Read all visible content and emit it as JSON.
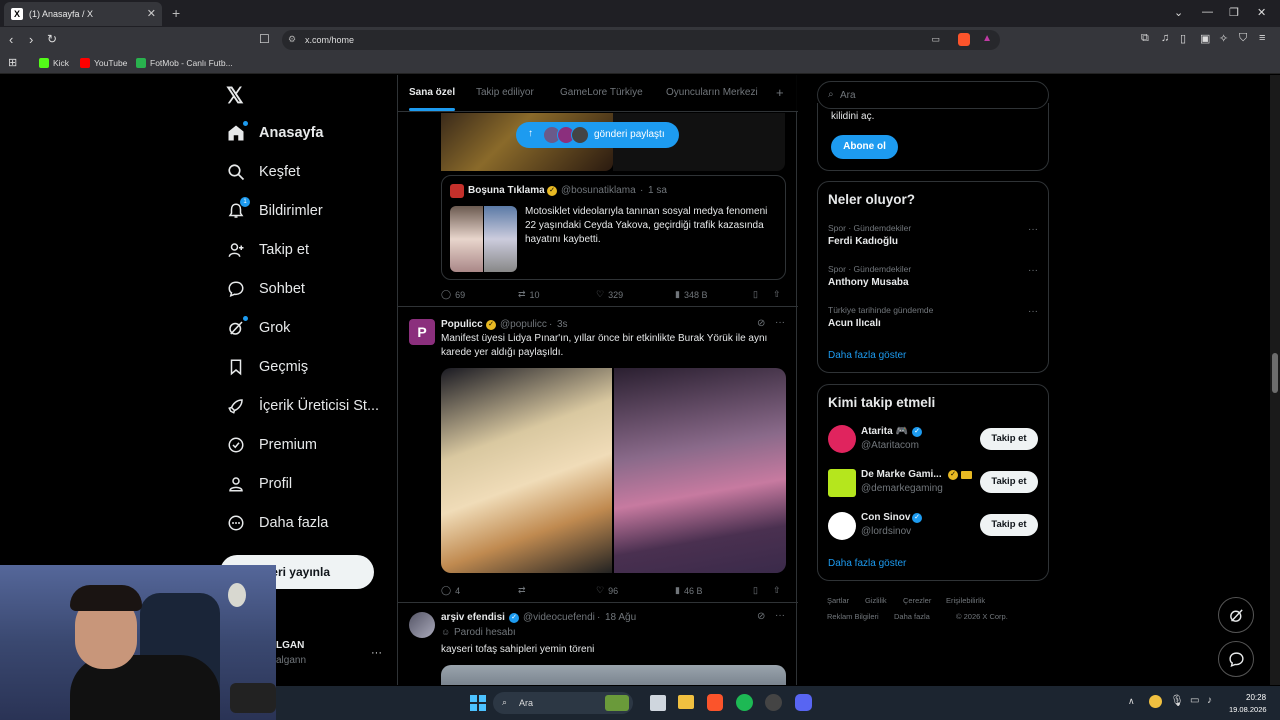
{
  "browser": {
    "tab_title": "(1) Anasayfa / X",
    "tab_favicon": "X",
    "url": "x.com/home",
    "bookmarks": [
      "Kick",
      "YouTube",
      "FotMob - Canlı Futb..."
    ]
  },
  "nav": {
    "items": [
      {
        "label": "Anasayfa",
        "icon": "home-icon"
      },
      {
        "label": "Keşfet",
        "icon": "search-icon"
      },
      {
        "label": "Bildirimler",
        "icon": "bell-icon",
        "badge": "1"
      },
      {
        "label": "Takip et",
        "icon": "person-plus-icon"
      },
      {
        "label": "Sohbet",
        "icon": "chat-icon"
      },
      {
        "label": "Grok",
        "icon": "grok-icon"
      },
      {
        "label": "Geçmiş",
        "icon": "bookmark-icon"
      },
      {
        "label": "İçerik Üreticisi St...",
        "icon": "rocket-icon"
      },
      {
        "label": "Premium",
        "icon": "verified-icon"
      },
      {
        "label": "Profil",
        "icon": "person-icon"
      },
      {
        "label": "Daha fazla",
        "icon": "more-circle-icon"
      }
    ],
    "post_button": "deri yayınla",
    "account_name": "LGAN",
    "account_handle": "algann"
  },
  "feed": {
    "tabs": [
      "Sana özel",
      "Takip ediliyor",
      "GameLore Türkiye",
      "Oyuncuların Merkezi"
    ],
    "share_pill": "gönderi paylaştı",
    "quoted_post": {
      "name": "Boşuna Tıklama",
      "handle": "@bosunatiklama",
      "time": "1 sa",
      "text": "Motosiklet videolarıyla tanınan sosyal medya fenomeni 22 yaşındaki Ceyda Yakova, geçirdiği trafik kazasında hayatını kaybetti.",
      "stats": {
        "replies": "69",
        "reposts": "10",
        "likes": "329",
        "views": "348 B"
      }
    },
    "post2": {
      "name": "Populicc",
      "handle": "@populicc",
      "time": "3s",
      "text": "Manifest üyesi Lidya Pınar'ın, yıllar önce bir etkinlikte Burak Yörük ile aynı karede yer aldığı paylaşıldı.",
      "stats": {
        "replies": "4",
        "reposts": "",
        "likes": "96",
        "views": "46 B"
      }
    },
    "post3": {
      "name": "arşiv efendisi",
      "handle": "@videocuefendi",
      "time": "18 Ağu",
      "subtitle": "Parodi hesabı",
      "text": "kayseri tofaş sahipleri yemin töreni"
    }
  },
  "sidebar": {
    "search_placeholder": "Ara",
    "premium_text": "kilidini aç.",
    "subscribe_button": "Abone ol",
    "trends_title": "Neler oluyor?",
    "trends": [
      {
        "category": "Spor · Gündemdekiler",
        "name": "Ferdi Kadıoğlu"
      },
      {
        "category": "Spor · Gündemdekiler",
        "name": "Anthony Musaba"
      },
      {
        "category": "Türkiye tarihinde gündemde",
        "name": "Acun Ilıcalı"
      }
    ],
    "trends_more": "Daha fazla göster",
    "who_to_follow_title": "Kimi takip etmeli",
    "suggestions": [
      {
        "name": "Atarita 🎮",
        "handle": "@Ataritacom",
        "button": "Takip et",
        "color": "#e0245e"
      },
      {
        "name": "De Marke Gami...",
        "handle": "@demarkegaming",
        "button": "Takip et",
        "color": "#b5e61d"
      },
      {
        "name": "Con Sinov",
        "handle": "@lordsinov",
        "button": "Takip et",
        "color": "#ffffff"
      }
    ],
    "follow_more": "Daha fazla göster",
    "footer": [
      "Şartlar",
      "Gizlilik",
      "Çerezler",
      "Erişilebilirlik",
      "Reklam Bilgileri",
      "Daha fazla",
      "© 2026 X Corp."
    ]
  },
  "taskbar": {
    "search_label": "Ara",
    "time": "20:28",
    "date": "19.08.2026"
  }
}
